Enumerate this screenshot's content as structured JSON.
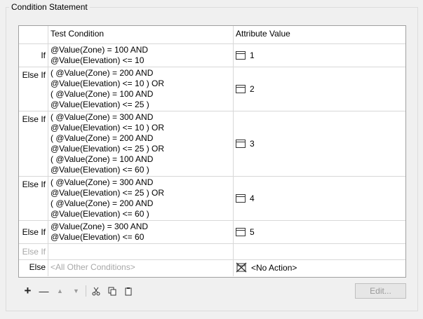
{
  "group_title": "Condition Statement",
  "table": {
    "headers": {
      "condition": "Test Condition",
      "value": "Attribute Value"
    },
    "rows": [
      {
        "label": "If",
        "lines": [
          "@Value(Zone) = 100 AND",
          "@Value(Elevation) <= 10"
        ],
        "value": "1",
        "icon": "attribute-icon"
      },
      {
        "label": "Else If",
        "lines": [
          "( @Value(Zone) = 200 AND",
          "@Value(Elevation) <= 10 ) OR",
          "( @Value(Zone) = 100 AND",
          "@Value(Elevation) <= 25 )"
        ],
        "value": "2",
        "icon": "attribute-icon"
      },
      {
        "label": "Else If",
        "lines": [
          "( @Value(Zone) = 300 AND",
          "@Value(Elevation) <= 10 ) OR",
          "( @Value(Zone) = 200 AND",
          "@Value(Elevation) <= 25 ) OR",
          "( @Value(Zone) = 100 AND",
          "@Value(Elevation) <= 60 )"
        ],
        "value": "3",
        "icon": "attribute-icon"
      },
      {
        "label": "Else If",
        "lines": [
          "( @Value(Zone) = 300 AND",
          "@Value(Elevation) <= 25 ) OR",
          "( @Value(Zone) = 200 AND",
          "@Value(Elevation) <= 60 )"
        ],
        "value": "4",
        "icon": "attribute-icon"
      },
      {
        "label": "Else If",
        "lines": [
          "@Value(Zone) = 300 AND",
          "@Value(Elevation) <= 60"
        ],
        "value": "5",
        "icon": "attribute-icon"
      }
    ],
    "empty_row": {
      "label": "Else If"
    },
    "else_row": {
      "label": "Else",
      "condition": "<All Other Conditions>",
      "value": "<No Action>",
      "icon": "no-action-icon"
    }
  },
  "toolbar": {
    "add": "+",
    "remove": "—",
    "up": "▲",
    "down": "▼",
    "cut_icon": "scissors-icon",
    "copy_icon": "copy-icon",
    "paste_icon": "paste-icon",
    "edit_label": "Edit..."
  }
}
